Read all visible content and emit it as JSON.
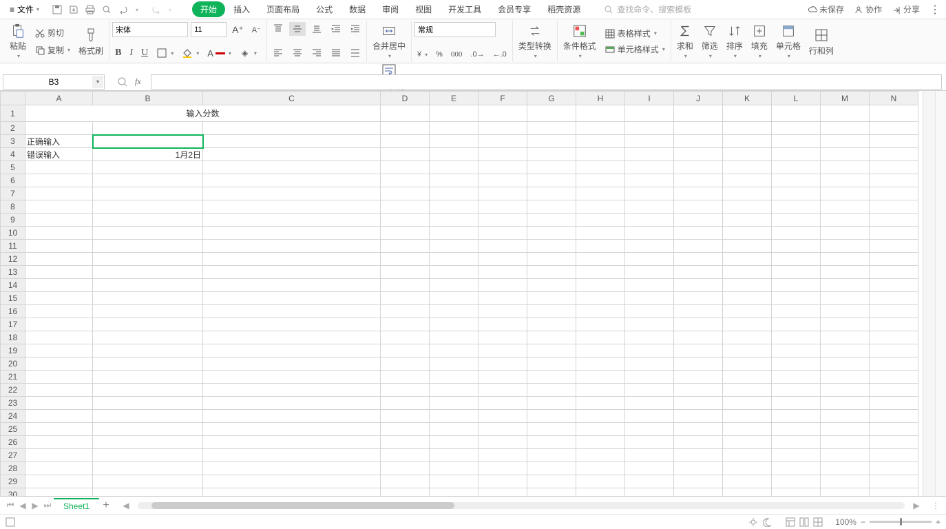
{
  "menu": {
    "file": "文件",
    "tabs": [
      "开始",
      "插入",
      "页面布局",
      "公式",
      "数据",
      "审阅",
      "视图",
      "开发工具",
      "会员专享",
      "稻壳资源"
    ],
    "active_tab": "开始",
    "search_placeholder": "查找命令、搜索模板",
    "unsaved": "未保存",
    "collab": "协作",
    "share": "分享"
  },
  "ribbon": {
    "paste": "粘贴",
    "cut": "剪切",
    "copy": "复制",
    "format_painter": "格式刷",
    "font_name": "宋体",
    "font_size": "11",
    "merge_center": "合并居中",
    "wrap": "自动换行",
    "number_format": "常规",
    "type_convert": "类型转换",
    "cond_fmt": "条件格式",
    "table_style": "表格样式",
    "cell_style": "单元格样式",
    "sum": "求和",
    "filter": "筛选",
    "sort": "排序",
    "fill": "填充",
    "cells": "单元格",
    "rowscols": "行和列"
  },
  "namebox": "B3",
  "columns": [
    "A",
    "B",
    "C",
    "D",
    "E",
    "F",
    "G",
    "H",
    "I",
    "J",
    "K",
    "L",
    "M",
    "N"
  ],
  "col_widths": {
    "A": 98,
    "B": 160,
    "C": 258
  },
  "row_count": 31,
  "active_cell": {
    "row": 3,
    "col": "B"
  },
  "cells": {
    "merge_title": {
      "range": "A1:C1",
      "value": "输入分数",
      "bold": true,
      "align": "center"
    },
    "A3": "正确输入",
    "A4": "错误输入",
    "B4": "1月2日"
  },
  "sheets": {
    "active": "Sheet1",
    "list": [
      "Sheet1"
    ]
  },
  "status": {
    "zoom": "100%"
  }
}
